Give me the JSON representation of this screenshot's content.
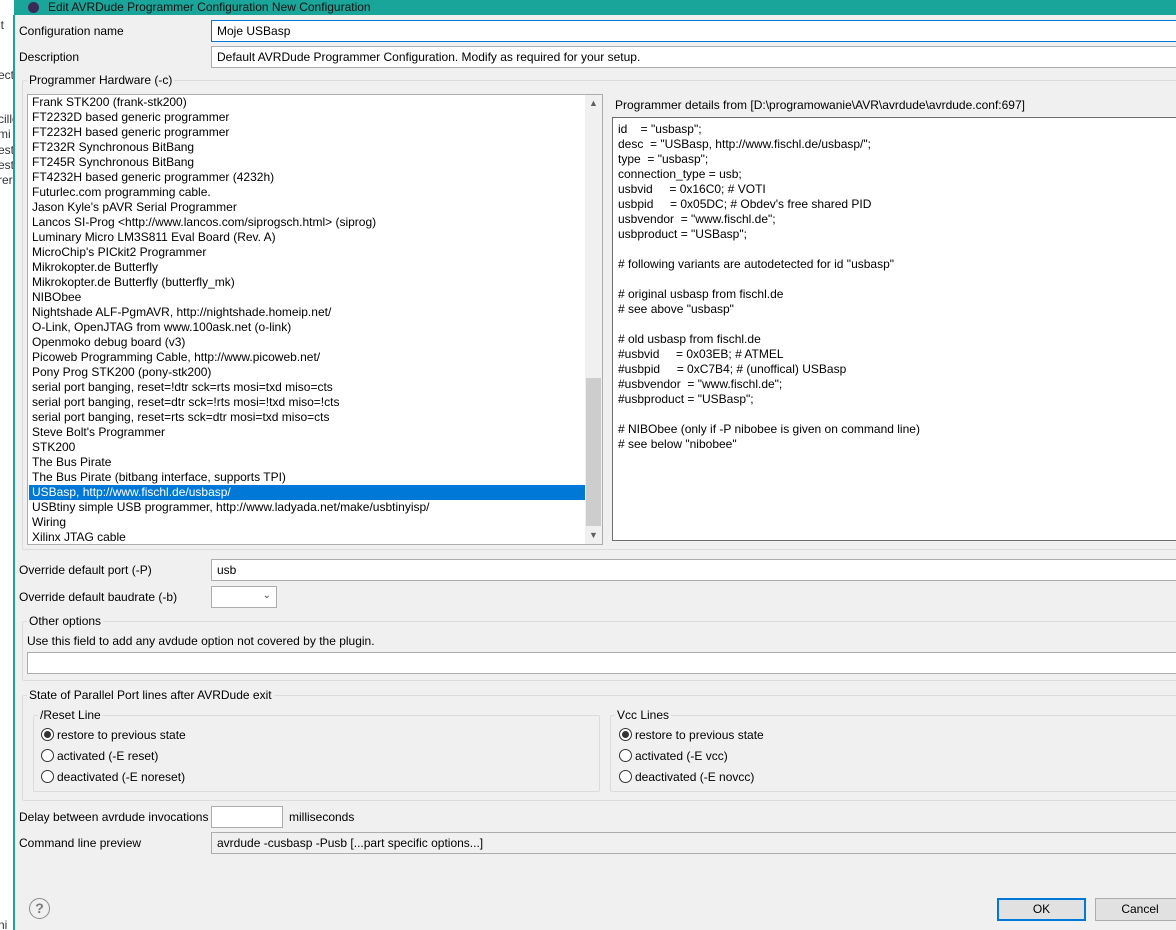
{
  "window": {
    "title": "Edit AVRDude Programmer Configuration New Configuration",
    "accent": "#1aa59a"
  },
  "background_window": {
    "fragments": [
      "it",
      "ect",
      "cille",
      "mi",
      "est",
      "est",
      "rer",
      "ni"
    ]
  },
  "config_name": {
    "label": "Configuration name",
    "value": "Moje USBasp"
  },
  "description": {
    "label": "Description",
    "value": "Default AVRDude Programmer Configuration. Modify as required for your setup."
  },
  "hardware": {
    "label": "Programmer Hardware (-c)",
    "selected": "USBasp, http://www.fischl.de/usbasp/",
    "selection_color": "#0078d7",
    "items": [
      "Frank STK200 (frank-stk200)",
      "FT2232D based generic programmer",
      "FT2232H based generic programmer",
      "FT232R Synchronous BitBang",
      "FT245R Synchronous BitBang",
      "FT4232H based generic programmer (4232h)",
      "Futurlec.com programming cable.",
      "Jason Kyle's pAVR Serial Programmer",
      "Lancos SI-Prog <http://www.lancos.com/siprogsch.html> (siprog)",
      "Luminary Micro LM3S811 Eval Board (Rev. A)",
      "MicroChip's PICkit2 Programmer",
      "Mikrokopter.de Butterfly",
      "Mikrokopter.de Butterfly (butterfly_mk)",
      "NIBObee",
      "Nightshade ALF-PgmAVR, http://nightshade.homeip.net/",
      "O-Link, OpenJTAG from www.100ask.net (o-link)",
      "Openmoko debug board (v3)",
      "Picoweb Programming Cable, http://www.picoweb.net/",
      "Pony Prog STK200 (pony-stk200)",
      "serial port banging, reset=!dtr sck=rts mosi=txd miso=cts",
      "serial port banging, reset=dtr sck=!rts mosi=!txd miso=!cts",
      "serial port banging, reset=rts sck=dtr mosi=txd miso=cts",
      "Steve Bolt's Programmer",
      "STK200",
      "The Bus Pirate",
      "The Bus Pirate (bitbang interface, supports TPI)",
      "USBasp, http://www.fischl.de/usbasp/",
      "USBtiny simple USB programmer, http://www.ladyada.net/make/usbtinyisp/",
      "Wiring",
      "Xilinx JTAG cable"
    ],
    "details_label": "Programmer details from [D:\\programowanie\\AVR\\avrdude\\avrdude.conf:697]",
    "details": "id    = \"usbasp\";\ndesc  = \"USBasp, http://www.fischl.de/usbasp/\";\ntype  = \"usbasp\";\nconnection_type = usb;\nusbvid     = 0x16C0; # VOTI\nusbpid     = 0x05DC; # Obdev's free shared PID\nusbvendor  = \"www.fischl.de\";\nusbproduct = \"USBasp\";\n\n# following variants are autodetected for id \"usbasp\"\n\n# original usbasp from fischl.de\n# see above \"usbasp\"\n\n# old usbasp from fischl.de\n#usbvid     = 0x03EB; # ATMEL\n#usbpid     = 0xC7B4; # (unoffical) USBasp\n#usbvendor  = \"www.fischl.de\";\n#usbproduct = \"USBasp\";\n\n# NIBObee (only if -P nibobee is given on command line)\n# see below \"nibobee\""
  },
  "port": {
    "label": "Override default port (-P)",
    "value": "usb"
  },
  "baudrate": {
    "label": "Override default baudrate (-b)",
    "value": ""
  },
  "other": {
    "label": "Other options",
    "hint": "Use this field to add any avdude option not covered by the plugin.",
    "value": ""
  },
  "parallel": {
    "label": "State of Parallel Port lines after AVRDude exit",
    "reset": {
      "label": "/Reset Line",
      "options": [
        "restore to previous state",
        "activated (-E reset)",
        "deactivated (-E noreset)"
      ],
      "selected": 0
    },
    "vcc": {
      "label": "Vcc Lines",
      "options": [
        "restore to previous state",
        "activated (-E vcc)",
        "deactivated (-E novcc)"
      ],
      "selected": 0
    }
  },
  "delay": {
    "label": "Delay between avrdude invocations",
    "value": "",
    "unit": "milliseconds"
  },
  "preview": {
    "label": "Command line preview",
    "value": "avrdude -cusbasp -Pusb  [...part specific options...]"
  },
  "buttons": {
    "ok": "OK",
    "cancel": "Cancel",
    "help": "?"
  }
}
